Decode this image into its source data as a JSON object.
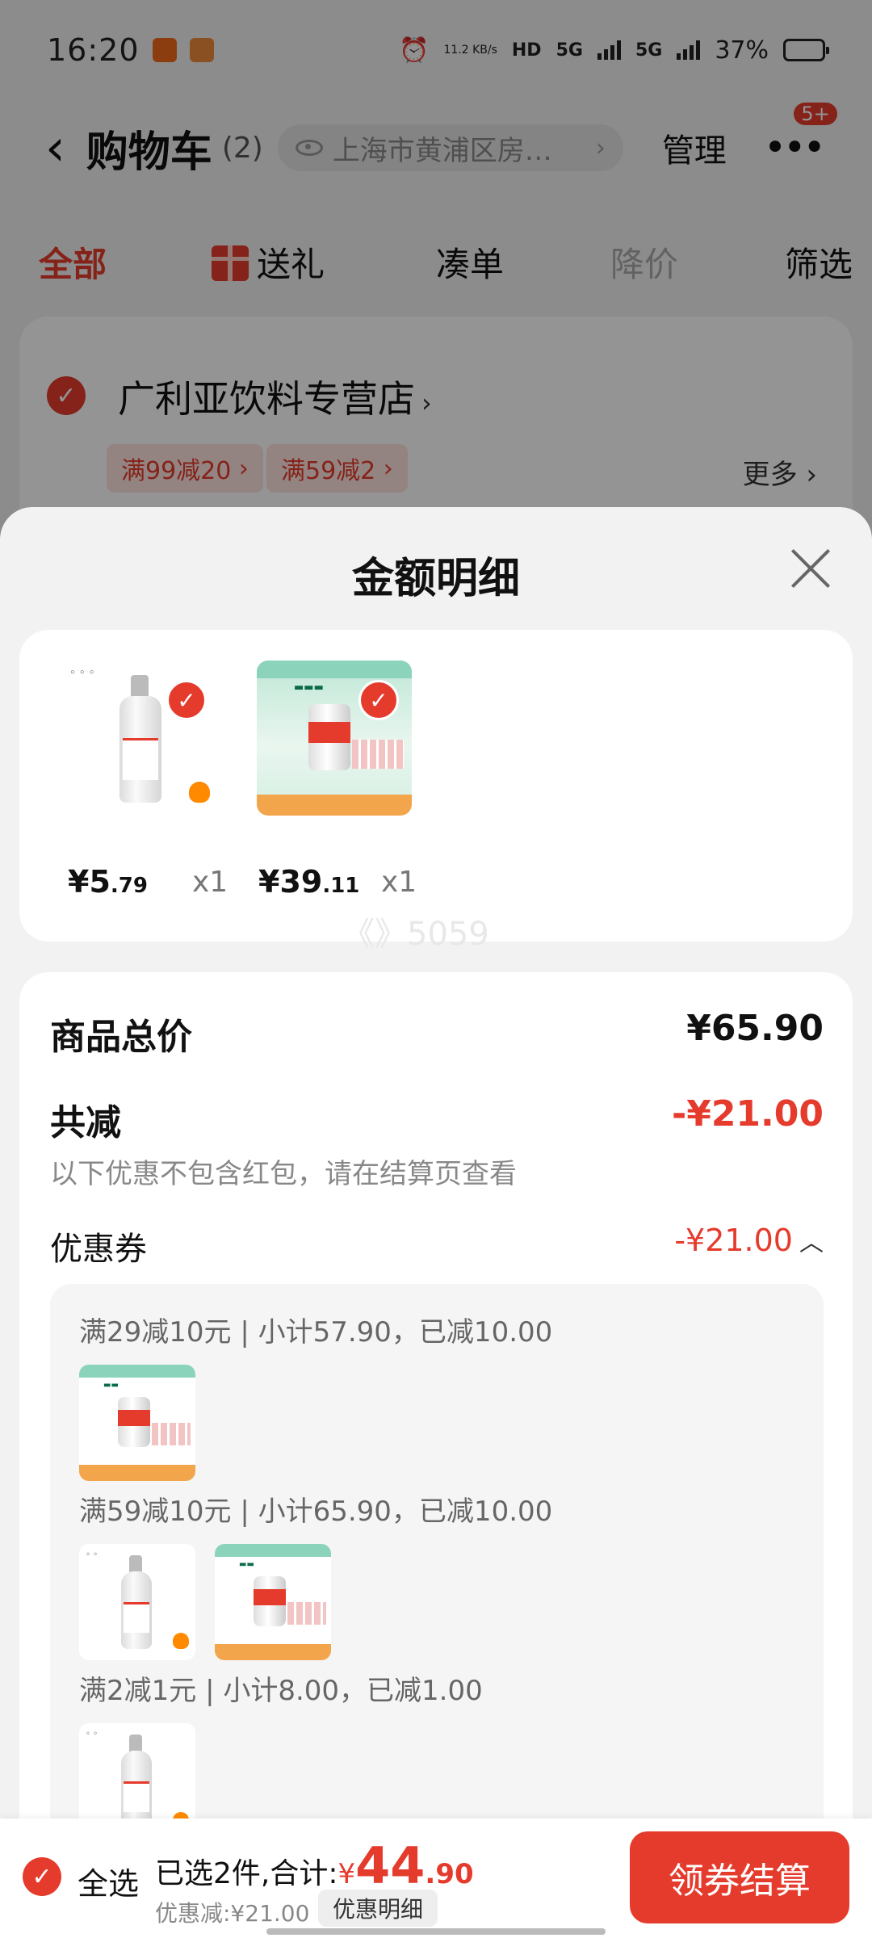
{
  "status_bar": {
    "time": "16:20",
    "net_speed": "11.2 KB/s",
    "hd": "HD",
    "signal_1": "5G",
    "signal_2": "5G",
    "battery": "37%"
  },
  "nav": {
    "title": "购物车",
    "count": "(2)",
    "address": "上海市黄浦区房…",
    "manage": "管理",
    "badge": "5+"
  },
  "tabs": [
    {
      "label": "全部"
    },
    {
      "label": "送礼"
    },
    {
      "label": "凑单"
    },
    {
      "label": "降价"
    },
    {
      "label": "筛选"
    }
  ],
  "store": {
    "name": "广利亚饮料专营店",
    "promos": [
      "满99减20",
      "满59减2"
    ],
    "more": "更多"
  },
  "sheet": {
    "title": "金额明细",
    "items": [
      {
        "price_int": "¥5",
        "price_dec": ".79",
        "qty": "x1",
        "image": "glass-bottle-soda"
      },
      {
        "price_int": "¥39",
        "price_dec": ".11",
        "qty": "x1",
        "image": "canned-drink-case"
      }
    ],
    "watermark": "《》5059",
    "total_label": "商品总价",
    "total_value": "¥65.90",
    "reduce_label": "共减",
    "reduce_value": "-¥21.00",
    "note": "以下优惠不包含红包，请在结算页查看",
    "coupon_label": "优惠券",
    "coupon_value": "-¥21.00",
    "coupon_rules": [
      {
        "text": "满29减10元 | 小计57.90，已减10.00",
        "items": [
          "canned-drink-case"
        ]
      },
      {
        "text": "满59减10元 | 小计65.90，已减10.00",
        "items": [
          "glass-bottle-soda",
          "canned-drink-case"
        ]
      },
      {
        "text": "满2减1元 | 小计8.00，已减1.00",
        "items": [
          "glass-bottle-soda"
        ]
      }
    ]
  },
  "bottom_bar": {
    "select_all": "全选",
    "selected_prefix": "已选2件,合计:",
    "yen": "¥",
    "total_int": "44",
    "total_dec": ".90",
    "discount": "优惠减:¥21.00",
    "detail_btn": "优惠明细",
    "checkout": "领券结算"
  },
  "colors": {
    "accent": "#e53b2c",
    "background": "#f2f2f2"
  }
}
